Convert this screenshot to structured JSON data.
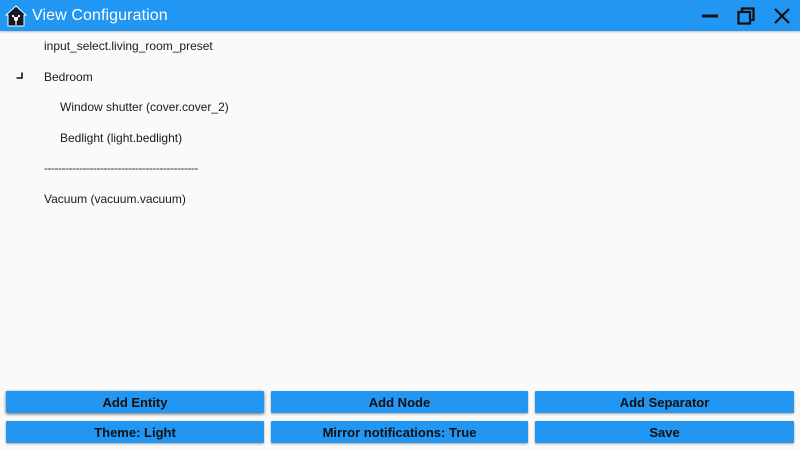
{
  "window": {
    "title": "View Configuration",
    "accent_color": "#2196f3",
    "controls": [
      "minimize-icon",
      "restore-icon",
      "close-icon"
    ]
  },
  "tree": {
    "rows": [
      {
        "label": "input_select.living_room_preset"
      },
      {
        "label": "Bedroom",
        "expanded": true
      },
      {
        "label": "Window shutter (cover.cover_2)"
      },
      {
        "label": "Bedlight (light.bedlight)"
      },
      {
        "label": "--------------------------------------------"
      },
      {
        "label": "Vacuum (vacuum.vacuum)"
      }
    ]
  },
  "buttons": {
    "add_entity": "Add Entity",
    "add_node": "Add Node",
    "add_separator": "Add Separator",
    "theme": "Theme: Light",
    "mirror_notifications": "Mirror notifications: True",
    "save": "Save"
  }
}
